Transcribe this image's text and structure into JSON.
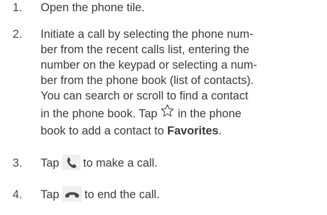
{
  "steps": [
    {
      "number": "1.",
      "lines": [
        "Open the phone tile."
      ]
    },
    {
      "number": "2.",
      "lines": [
        "Initiate a call by selecting the phone num-",
        "ber from the recent calls list, entering the",
        "number on the keypad or selecting a num-",
        "ber from the phone book (list of contacts).",
        "You can search or scroll to find a contact"
      ],
      "line6_before": "in the phone book. Tap",
      "line6_after": "in the phone",
      "line7_before": "book to add a contact to",
      "favorites": "Favorites",
      "line7_after": "."
    },
    {
      "number": "3.",
      "before": "Tap",
      "after": "to make a call."
    },
    {
      "number": "4.",
      "before": "Tap",
      "after": "to end the call."
    }
  ],
  "icons": {
    "star": "star-outline-icon",
    "call": "phone-handset-icon",
    "end_call": "end-call-icon"
  },
  "colors": {
    "text": "#3a3a3a",
    "icon": "#4a4a4a",
    "icon_bg": "#efefef"
  }
}
